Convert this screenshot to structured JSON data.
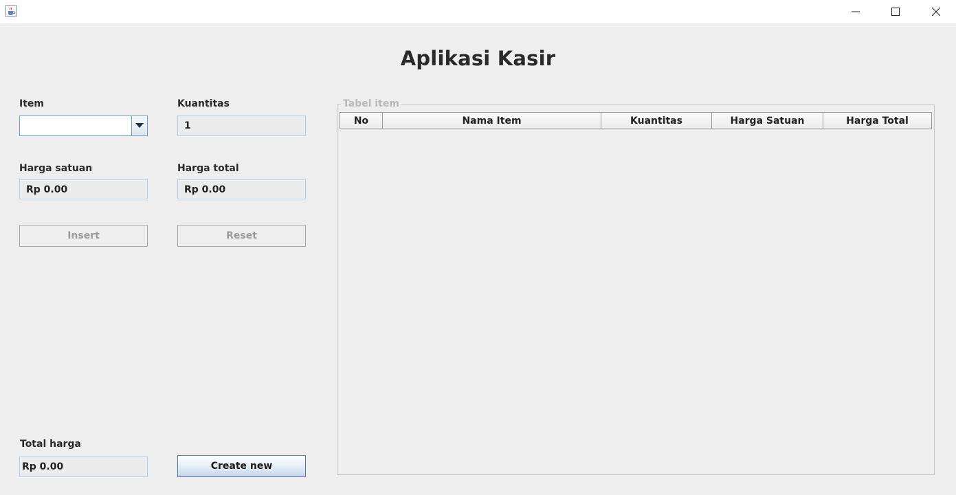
{
  "window": {
    "icons": {
      "app": "java-cup-icon",
      "minimize": "minimize-icon",
      "maximize": "maximize-icon",
      "close": "close-icon"
    }
  },
  "heading": "Aplikasi Kasir",
  "form": {
    "item_label": "Item",
    "item_value": "",
    "kuantitas_label": "Kuantitas",
    "kuantitas_value": "1",
    "harga_satuan_label": "Harga satuan",
    "harga_satuan_value": "Rp 0.00",
    "harga_total_label": "Harga total",
    "harga_total_value": "Rp 0.00",
    "insert_label": "Insert",
    "reset_label": "Reset",
    "total_harga_label": "Total harga",
    "total_harga_value": "Rp 0.00",
    "create_new_label": "Create new"
  },
  "table": {
    "title": "Tabel item",
    "columns": [
      "No",
      "Nama Item",
      "Kuantitas",
      "Harga Satuan",
      "Harga Total"
    ],
    "rows": []
  },
  "colors": {
    "background": "#eeeeee",
    "field_border": "#b8cfe5",
    "accent_button": "#c7d7ea"
  }
}
